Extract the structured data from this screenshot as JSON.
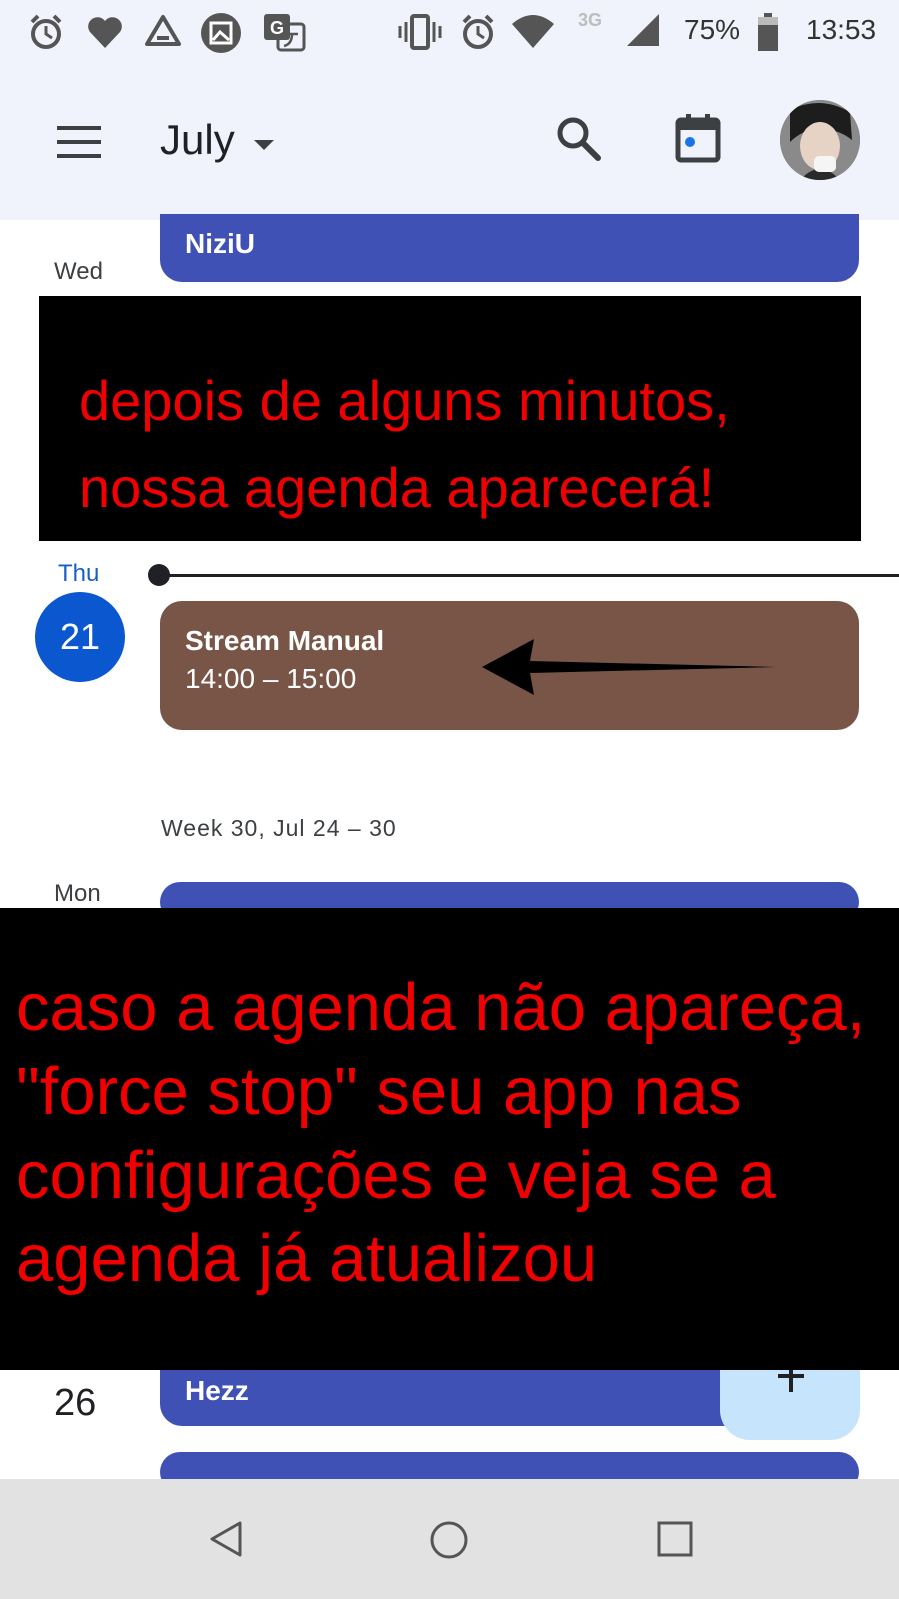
{
  "status_bar": {
    "network": "3G",
    "battery": "75%",
    "time": "13:53"
  },
  "app_bar": {
    "month": "July"
  },
  "days": [
    {
      "label": "Wed",
      "events": [
        {
          "title": "NiziU"
        }
      ]
    },
    {
      "label": "Thu",
      "date": "21",
      "events": [
        {
          "title": "Stream Manual",
          "time": "14:00 – 15:00"
        }
      ]
    }
  ],
  "week_header": "Week 30, Jul 24 – 30",
  "next_days": [
    {
      "label": "Mon"
    },
    {
      "date": "26",
      "events": [
        {
          "title": "Hezz"
        }
      ]
    }
  ],
  "overlays": {
    "top_text": "depois de alguns minutos, nossa agenda aparecerá!",
    "bottom_text": "caso a agenda não apareça, \"force stop\" seu app nas configurações e veja se a agenda já atualizou"
  },
  "colors": {
    "event_blue": "#3f51b5",
    "event_brown": "#795548",
    "today_blue": "#0b57d0",
    "overlay_text_red": "#f00000",
    "fab_background": "#c7e4fd"
  }
}
